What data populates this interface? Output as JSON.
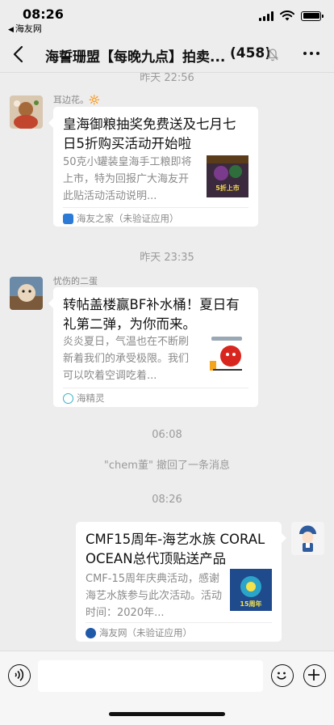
{
  "status": {
    "time": "08:26",
    "back_app": "海友网"
  },
  "nav": {
    "title": "海誓珊盟【每晚九点】拍卖...",
    "count": "(458)"
  },
  "timestamps": {
    "t1": "昨天 22:56",
    "t2": "昨天 23:35",
    "t3": "06:08",
    "t4": "08:26"
  },
  "messages": [
    {
      "sender": "耳边花。🔆",
      "title": "皇海御粮抽奖免费送及七月七日5折购买活动开始啦",
      "desc": "50克小罐装皇海手工粮即将上市，特为回报广大海友开此贴活动活动说明...",
      "source": "海友之家（未验证应用）",
      "thumb_text": "5折上市"
    },
    {
      "sender": "忧伤的二蛋",
      "title": "转帖盖楼赢BF补水桶！夏日有礼第二弹，为你而来。",
      "desc": "炎炎夏日，气温也在不断刷新着我们的承受极限。我们可以吹着空调吃着...",
      "source": "海精灵"
    },
    {
      "title": "CMF15周年-海艺水族 CORAL OCEAN总代顶贴送产品",
      "desc": "CMF-15周年庆典活动，感谢海艺水族参与此次活动。活动时间：2020年...",
      "source": "海友网（未验证应用）",
      "thumb_text": "15周年"
    }
  ],
  "system_message": "\"chem董\" 撤回了一条消息",
  "colors": {
    "background": "#ededed",
    "card": "#ffffff",
    "muted_text": "#9b9b9b"
  }
}
